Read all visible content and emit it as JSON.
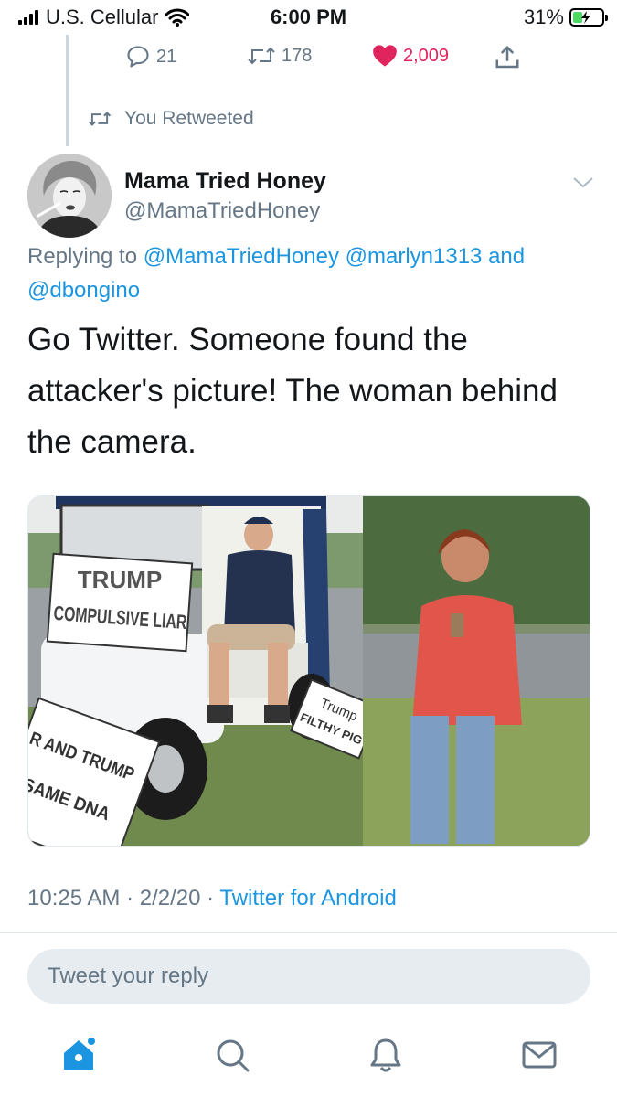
{
  "status_bar": {
    "carrier": "U.S. Cellular",
    "time": "6:00 PM",
    "battery": "31%"
  },
  "parent_tweet": {
    "replies": "21",
    "retweets": "178",
    "likes": "2,009"
  },
  "retweet_context": {
    "label": "You Retweeted"
  },
  "tweet": {
    "author_name": "Mama Tried Honey",
    "author_handle": "@MamaTriedHoney",
    "replying_prefix": "Replying to",
    "mention_1": "@MamaTriedHoney",
    "mention_2": "@marlyn1313",
    "and_word": "and",
    "mention_3": "@dbongino",
    "text": "Go Twitter. Someone found the attacker's picture! The woman behind the camera.",
    "time": "10:25 AM",
    "date": "2/2/20",
    "separator": "·",
    "source": "Twitter for Android"
  },
  "media": {
    "sign_1_line_1": "TRUMP",
    "sign_1_line_2": "COMPULSIVE LIAR",
    "sign_2_line_1": "R AND TRUMP",
    "sign_2_line_2": "SAME DNA",
    "sign_3_line_1": "Trump",
    "sign_3_line_2": "FILTHY PIG"
  },
  "reply": {
    "placeholder": "Tweet your reply"
  },
  "colors": {
    "accent": "#1b95e0",
    "like": "#e0245e",
    "muted": "#657786"
  },
  "icons": {
    "tabs": [
      "home-icon",
      "search-icon",
      "notifications-icon",
      "messages-icon"
    ]
  }
}
